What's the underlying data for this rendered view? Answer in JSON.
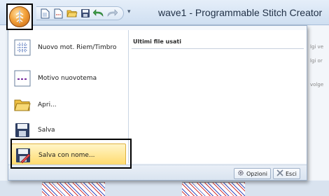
{
  "window": {
    "title": "wave1 - Programmable Stitch Creator"
  },
  "quick_access_toolbar": {
    "buttons": [
      {
        "icon": "new-document-icon"
      },
      {
        "icon": "new-pattern-icon"
      },
      {
        "icon": "open-folder-icon"
      },
      {
        "icon": "save-icon"
      },
      {
        "icon": "undo-icon"
      },
      {
        "icon": "redo-icon"
      }
    ],
    "customize_glyph": "▾"
  },
  "app_menu": {
    "items": [
      {
        "label": "Nuovo mot. Riem/Timbro",
        "icon": "new-fill-stamp-icon"
      },
      {
        "label": "Motivo nuovotema",
        "icon": "new-motif-icon"
      },
      {
        "label": "Apri...",
        "icon": "open-folder-icon"
      },
      {
        "label": "Salva",
        "icon": "save-icon"
      },
      {
        "label": "Salva con nome...",
        "icon": "save-as-icon",
        "highlighted": true
      }
    ],
    "recent_header": "Ultimi file usati",
    "footer": {
      "options_label": "Opzioni",
      "exit_label": "Esci"
    }
  },
  "background_fragments": {
    "line1": "lgi ve",
    "line2": "lgi or",
    "line3": "volge"
  },
  "colors": {
    "highlight": "#ffd865",
    "frame": "#9fb3cc",
    "accent_orb": "#f3a23a"
  }
}
